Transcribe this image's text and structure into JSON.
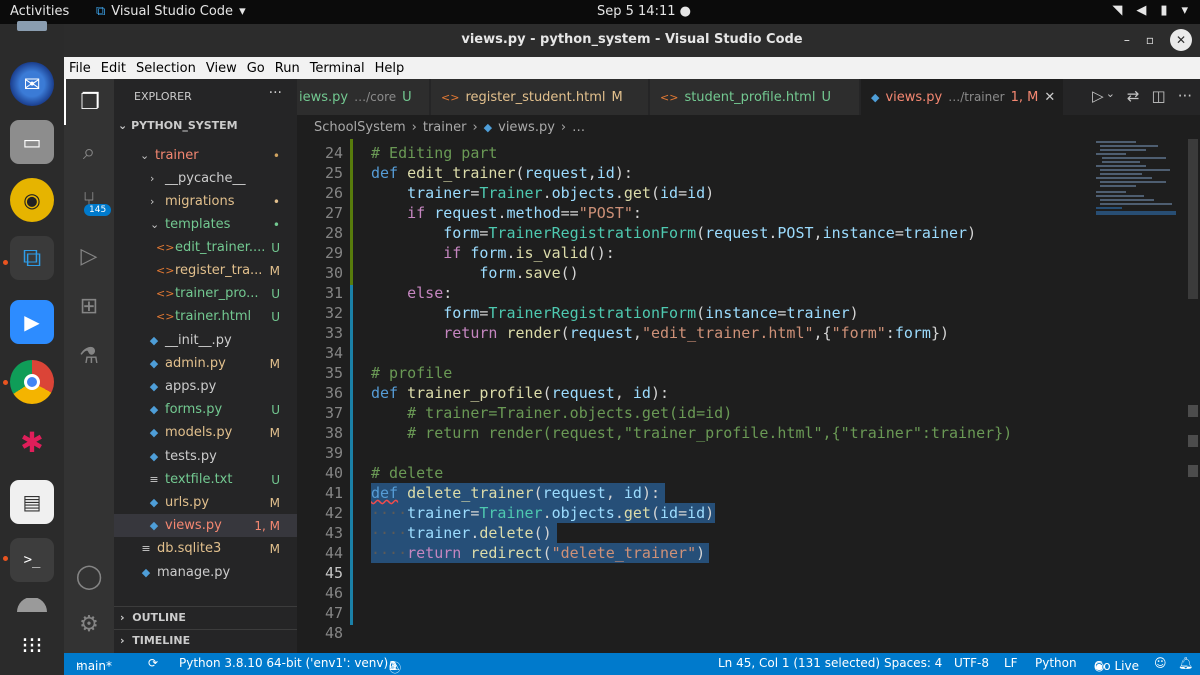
{
  "gnome": {
    "activities": "Activities",
    "app_name": "Visual Studio Code",
    "datetime": "Sep 5  14:11"
  },
  "window": {
    "title": "views.py - python_system - Visual Studio Code"
  },
  "menu": [
    "File",
    "Edit",
    "Selection",
    "View",
    "Go",
    "Run",
    "Terminal",
    "Help"
  ],
  "sidebar": {
    "title": "EXPLORER",
    "project": "PYTHON_SYSTEM",
    "scm_badge": "145",
    "tree": [
      {
        "name": "trainer",
        "status": "•",
        "kind": "folder"
      },
      {
        "name": "__pycache__",
        "status": "",
        "kind": "folder"
      },
      {
        "name": "migrations",
        "status": "•",
        "kind": "folder"
      },
      {
        "name": "templates",
        "status": "•",
        "kind": "folder"
      },
      {
        "name": "edit_trainer....",
        "status": "U",
        "kind": "html"
      },
      {
        "name": "register_tra...",
        "status": "M",
        "kind": "html"
      },
      {
        "name": "trainer_pro...",
        "status": "U",
        "kind": "html"
      },
      {
        "name": "trainer.html",
        "status": "U",
        "kind": "html"
      },
      {
        "name": "__init__.py",
        "status": "",
        "kind": "py"
      },
      {
        "name": "admin.py",
        "status": "M",
        "kind": "py"
      },
      {
        "name": "apps.py",
        "status": "",
        "kind": "py"
      },
      {
        "name": "forms.py",
        "status": "U",
        "kind": "py"
      },
      {
        "name": "models.py",
        "status": "M",
        "kind": "py"
      },
      {
        "name": "tests.py",
        "status": "",
        "kind": "py"
      },
      {
        "name": "textfile.txt",
        "status": "U",
        "kind": "txt"
      },
      {
        "name": "urls.py",
        "status": "M",
        "kind": "py"
      },
      {
        "name": "views.py",
        "status": "1, M",
        "kind": "py"
      },
      {
        "name": "db.sqlite3",
        "status": "M",
        "kind": "db"
      },
      {
        "name": "manage.py",
        "status": "",
        "kind": "py"
      }
    ],
    "sections": [
      "OUTLINE",
      "TIMELINE"
    ]
  },
  "tabs": [
    {
      "label": "iews.py",
      "path": "…/core",
      "status": "U"
    },
    {
      "label": "register_student.html",
      "path": "",
      "status": "M"
    },
    {
      "label": "student_profile.html",
      "path": "",
      "status": "U"
    },
    {
      "label": "views.py",
      "path": "…/trainer",
      "status": "1, M"
    }
  ],
  "breadcrumb": [
    "SchoolSystem",
    "trainer",
    "views.py",
    "…"
  ],
  "editor": {
    "line_numbers": [
      "24",
      "25",
      "26",
      "27",
      "28",
      "29",
      "30",
      "31",
      "32",
      "33",
      "34",
      "35",
      "36",
      "37",
      "38",
      "39",
      "40",
      "41",
      "42",
      "43",
      "44",
      "45",
      "46",
      "47",
      "48"
    ]
  },
  "status": {
    "branch": "main*",
    "interpreter": "Python 3.8.10 64-bit ('env1': venv)",
    "errors": "1",
    "warnings": "0",
    "cursor": "Ln 45, Col 1 (131 selected)",
    "spaces": "Spaces: 4",
    "encoding": "UTF-8",
    "eol": "LF",
    "language": "Python",
    "golive": "Go Live"
  }
}
